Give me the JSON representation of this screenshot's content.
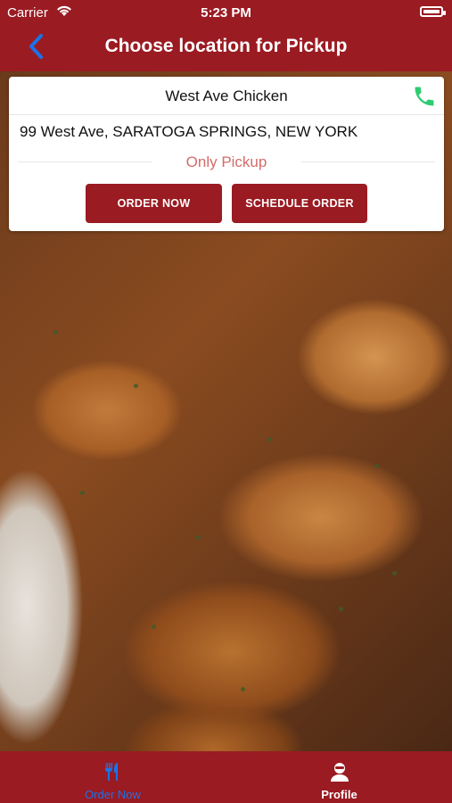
{
  "status_bar": {
    "carrier": "Carrier",
    "time": "5:23 PM"
  },
  "header": {
    "title": "Choose location for Pickup",
    "back_icon": "chevron-left-icon"
  },
  "location": {
    "name": "West Ave Chicken",
    "address": "99 West Ave, SARATOGA SPRINGS, NEW YORK",
    "mode": "Only Pickup",
    "phone_icon": "phone-icon",
    "order_now_label": "ORDER NOW",
    "schedule_label": "SCHEDULE ORDER"
  },
  "tabs": [
    {
      "label": "Order Now",
      "icon": "utensils-icon",
      "active": true
    },
    {
      "label": "Profile",
      "icon": "profile-icon",
      "active": false
    }
  ],
  "colors": {
    "brand": "#9a1b22",
    "active_tab": "#1a73e8",
    "phone": "#2ecc71",
    "mode_text": "#d46b6b"
  }
}
